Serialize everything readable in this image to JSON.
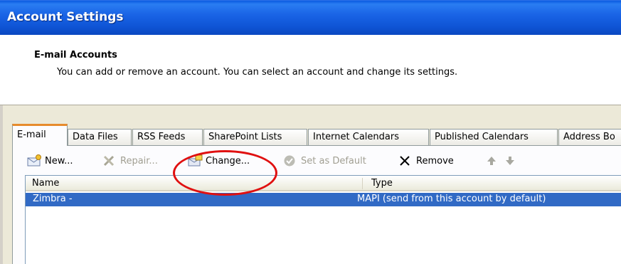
{
  "window": {
    "title": "Account Settings"
  },
  "header": {
    "title": "E-mail Accounts",
    "subtitle": "You can add or remove an account. You can select an account and change its settings."
  },
  "tabs": [
    {
      "label": "E-mail",
      "active": true
    },
    {
      "label": "Data Files"
    },
    {
      "label": "RSS Feeds"
    },
    {
      "label": "SharePoint Lists"
    },
    {
      "label": "Internet Calendars"
    },
    {
      "label": "Published Calendars"
    },
    {
      "label": "Address Bo"
    }
  ],
  "toolbar": {
    "new_label": "New...",
    "repair_label": "Repair...",
    "change_label": "Change...",
    "set_default_label": "Set as Default",
    "remove_label": "Remove"
  },
  "list": {
    "columns": [
      "Name",
      "Type"
    ],
    "rows": [
      {
        "name": "Zimbra -",
        "type": "MAPI (send from this account by default)",
        "selected": true
      }
    ]
  },
  "colors": {
    "annotation_circle": "#e01010",
    "selection": "#316ac5",
    "title_bar": "#0f55d6"
  }
}
